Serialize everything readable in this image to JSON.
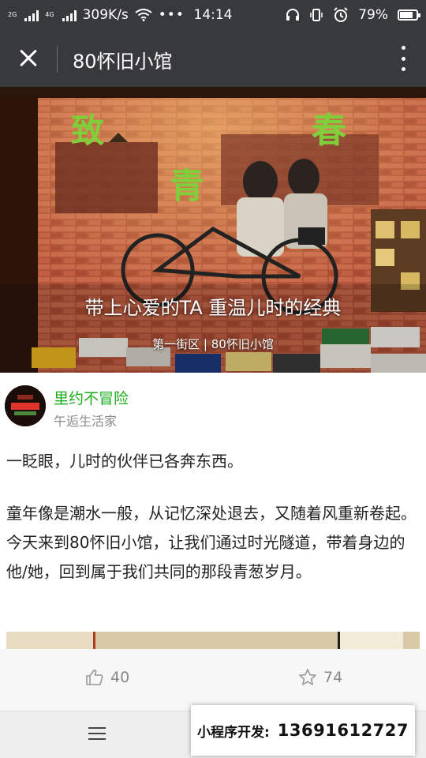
{
  "status_bar": {
    "network_left": "2G",
    "network_right": "4G",
    "speed": "309K/s",
    "time": "14:14",
    "battery_percent": "79%",
    "battery_level": 0.79
  },
  "header": {
    "title": "80怀旧小馆"
  },
  "hero": {
    "title": "带上心爱的TA 重温儿时的经典",
    "subtitle": "第一街区 | 80怀旧小馆"
  },
  "author": {
    "name": "里约不冒险",
    "tagline": "午逅生活家"
  },
  "article": {
    "paragraphs": [
      "一眨眼，儿时的伙伴已各奔东西。",
      "童年像是潮水一般，从记忆深处退去，又随着风重新卷起。今天来到80怀旧小馆，让我们通过时光隧道，带着身边的他/她，回到属于我们共同的那段青葱岁月。"
    ]
  },
  "reactions": {
    "likes": "40",
    "stars": "74"
  },
  "promo": {
    "label": "小程序开发:",
    "phone": "13691612727"
  },
  "colors": {
    "topbar": "#38393d",
    "author_name": "#1aad19",
    "muted": "#8c8c8c"
  }
}
